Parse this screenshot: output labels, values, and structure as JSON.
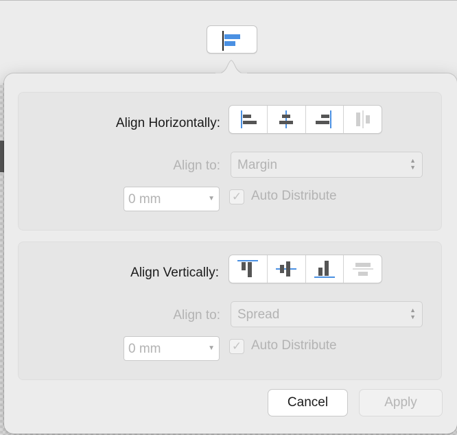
{
  "trigger": {
    "icon": "align-left-icon"
  },
  "horizontal": {
    "label": "Align Horizontally:",
    "buttons": [
      {
        "icon": "align-left-icon"
      },
      {
        "icon": "align-center-horizontal-icon"
      },
      {
        "icon": "align-right-icon"
      },
      {
        "icon": "distribute-horizontal-icon"
      }
    ],
    "align_to_label": "Align to:",
    "align_to_value": "Margin",
    "spacing_value": "0 mm",
    "auto_distribute_label": "Auto Distribute",
    "auto_distribute_checked": true
  },
  "vertical": {
    "label": "Align Vertically:",
    "buttons": [
      {
        "icon": "align-top-icon"
      },
      {
        "icon": "align-middle-vertical-icon"
      },
      {
        "icon": "align-bottom-icon"
      },
      {
        "icon": "distribute-vertical-icon"
      }
    ],
    "align_to_label": "Align to:",
    "align_to_value": "Spread",
    "spacing_value": "0 mm",
    "auto_distribute_label": "Auto Distribute",
    "auto_distribute_checked": true
  },
  "footer": {
    "cancel_label": "Cancel",
    "apply_label": "Apply"
  },
  "colors": {
    "accent": "#4a90e2",
    "icon_bar": "#555555",
    "icon_disabled": "#cfcfcf"
  }
}
